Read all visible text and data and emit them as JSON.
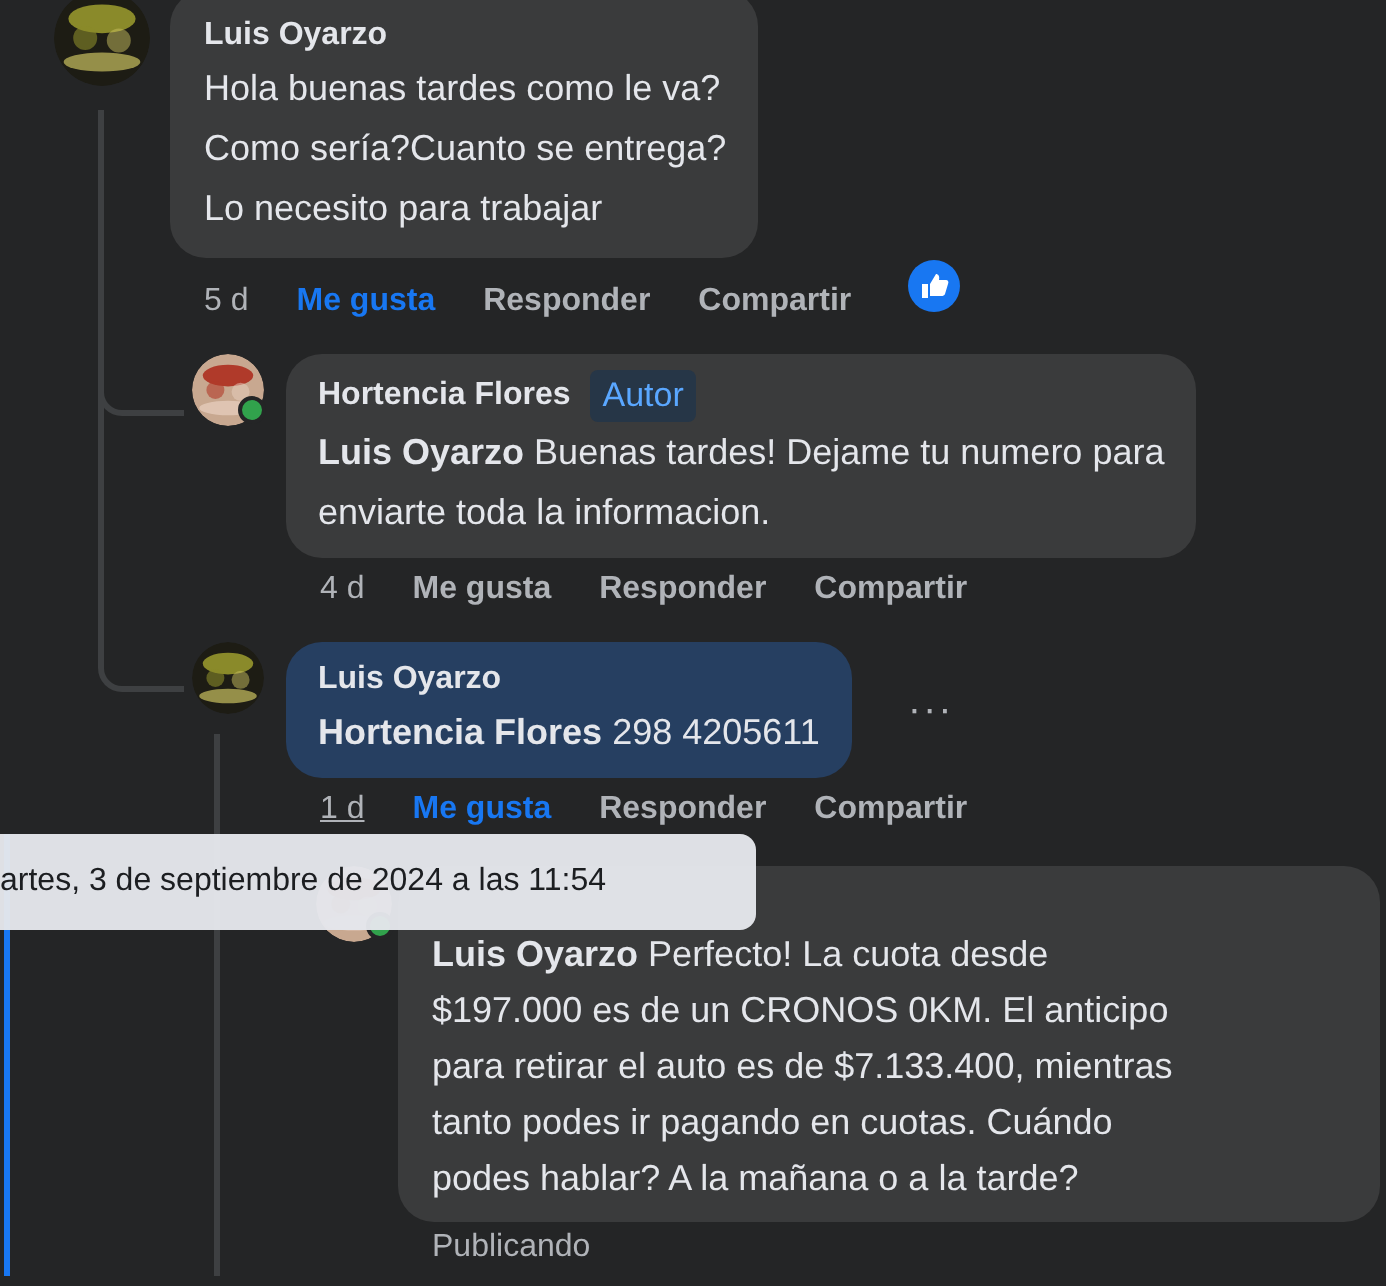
{
  "comment": {
    "author": "Luis Oyarzo",
    "lines": [
      "Hola buenas tardes como le va?",
      "Como sería?Cuanto se entrega?",
      "Lo necesito para trabajar"
    ],
    "time": "5 d",
    "time_underlined": false,
    "liked": true,
    "like_reaction": true,
    "actions": [
      "Me gusta",
      "Responder",
      "Compartir"
    ],
    "replies": [
      {
        "author": "Hortencia Flores",
        "badge": "Autor",
        "online": true,
        "highlighted": false,
        "mention": "Luis Oyarzo",
        "lines": [
          "Buenas tardes! Dejame tu numero para",
          "enviarte toda la informacion."
        ],
        "time": "4 d",
        "time_underlined": false,
        "liked": false,
        "actions": [
          "Me gusta",
          "Responder",
          "Compartir"
        ]
      },
      {
        "author": "Luis Oyarzo",
        "online": false,
        "highlighted": true,
        "menu": "···",
        "mention": "Hortencia Flores",
        "lines": [
          "298 4205611"
        ],
        "time": "1 d",
        "time_underlined": true,
        "liked": true,
        "actions": [
          "Me gusta",
          "Responder",
          "Compartir"
        ],
        "children": [
          {
            "online": true,
            "highlighted": false,
            "mention": "Luis Oyarzo",
            "lines": [
              "Perfecto! La cuota desde",
              "$197.000 es de un CRONOS 0KM. El anticipo",
              "para retirar el auto es de $7.133.400, mientras",
              "tanto podes ir pagando en cuotas. Cuándo",
              "podes hablar? A la mañana o a la tarde?"
            ],
            "status": "Publicando"
          }
        ]
      }
    ]
  },
  "tooltip": "artes, 3 de septiembre de 2024 a las 11:54"
}
